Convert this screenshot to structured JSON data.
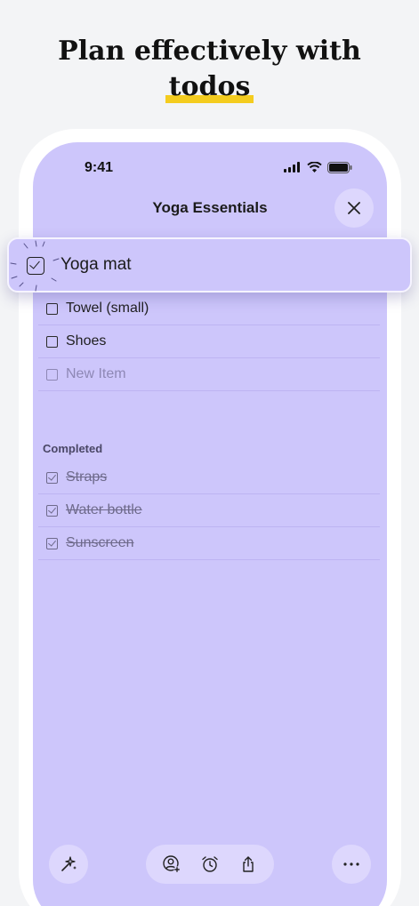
{
  "headline": {
    "line1": "Plan effectively with",
    "line2": "todos"
  },
  "status_bar": {
    "time": "9:41"
  },
  "list": {
    "title": "Yoga Essentials",
    "dragging_item": "Yoga mat",
    "items": [
      {
        "label": "Towel (small)"
      },
      {
        "label": "Shoes"
      }
    ],
    "new_item_placeholder": "New Item",
    "completed_label": "Completed",
    "completed_items": [
      {
        "label": "Straps"
      },
      {
        "label": "Water bottle"
      },
      {
        "label": "Sunscreen"
      }
    ]
  },
  "colors": {
    "screen_bg": "#cdc6fb",
    "button_bg": "#ddd7fd",
    "highlight": "#f4cc1f"
  },
  "icons": {
    "close": "close-icon",
    "magic": "sparkle-icon",
    "collaborator": "add-person-icon",
    "reminder": "alarm-clock-icon",
    "share": "share-icon",
    "more": "more-icon"
  }
}
